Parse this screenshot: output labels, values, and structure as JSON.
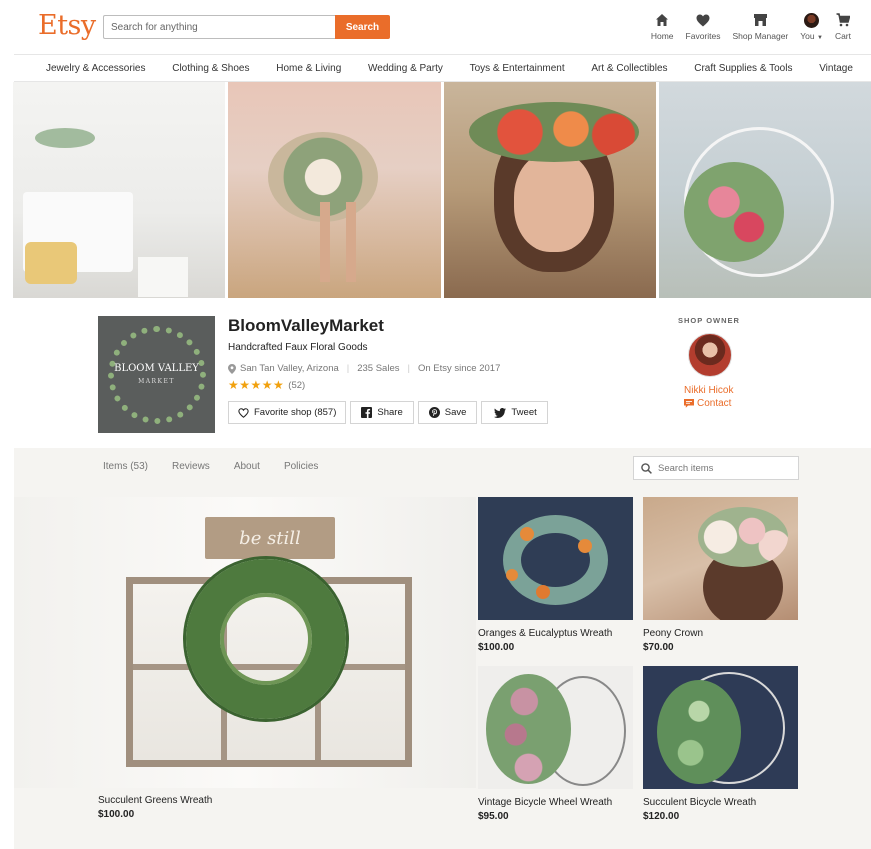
{
  "header": {
    "logo": "Etsy",
    "search_placeholder": "Search for anything",
    "search_button": "Search",
    "nav": [
      {
        "label": "Home",
        "icon": "home-icon"
      },
      {
        "label": "Favorites",
        "icon": "heart-icon"
      },
      {
        "label": "Shop Manager",
        "icon": "shop-manager-icon"
      },
      {
        "label": "You",
        "icon": "avatar"
      },
      {
        "label": "Cart",
        "icon": "cart-icon"
      }
    ]
  },
  "categories": [
    "Jewelry & Accessories",
    "Clothing & Shoes",
    "Home & Living",
    "Wedding & Party",
    "Toys & Entertainment",
    "Art & Collectibles",
    "Craft Supplies & Tools",
    "Vintage"
  ],
  "shop": {
    "logo_text": "BLOOM VALLEY",
    "logo_subtext": "MARKET",
    "name": "BloomValleyMarket",
    "tagline": "Handcrafted Faux Floral Goods",
    "location": "San Tan Valley, Arizona",
    "sales": "235 Sales",
    "since": "On Etsy since 2017",
    "stars": "★★★★★",
    "rating_count": "(52)",
    "actions": {
      "favorite": "Favorite shop (857)",
      "share": "Share",
      "save": "Save",
      "tweet": "Tweet"
    }
  },
  "owner": {
    "label": "SHOP OWNER",
    "name": "Nikki Hicok",
    "contact": "Contact"
  },
  "tabs": [
    "Items (53)",
    "Reviews",
    "About",
    "Policies"
  ],
  "item_search_placeholder": "Search items",
  "featured": {
    "sign_text": "be still",
    "title": "Succulent Greens Wreath",
    "price": "$100.00"
  },
  "items": [
    {
      "title": "Oranges & Eucalyptus Wreath",
      "price": "$100.00"
    },
    {
      "title": "Peony Crown",
      "price": "$70.00"
    },
    {
      "title": "Vintage Bicycle Wheel Wreath",
      "price": "$95.00"
    },
    {
      "title": "Succulent Bicycle Wreath",
      "price": "$120.00"
    }
  ],
  "colors": {
    "brand": "#ea6d2a",
    "star": "#f1a10e"
  }
}
